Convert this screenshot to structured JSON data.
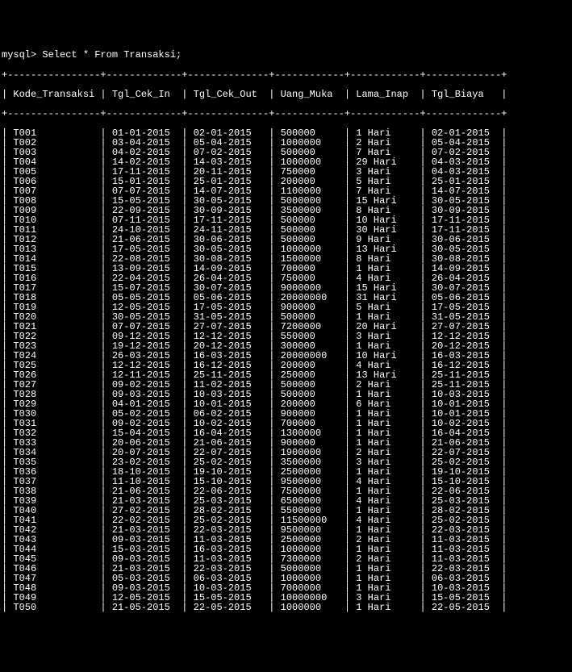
{
  "prompt": "mysql> Select * From Transaksi;",
  "columns": [
    "Kode_Transaksi",
    "Tgl_Cek_In",
    "Tgl_Cek_Out",
    "Uang_Muka",
    "Lama_Inap",
    "Tgl_Biaya"
  ],
  "rows": [
    {
      "kode": "T001",
      "cek_in": "01-01-2015",
      "cek_out": "02-01-2015",
      "uang": "500000",
      "lama": "1 Hari",
      "biaya": "02-01-2015"
    },
    {
      "kode": "T002",
      "cek_in": "03-04-2015",
      "cek_out": "05-04-2015",
      "uang": "1000000",
      "lama": "2 Hari",
      "biaya": "05-04-2015"
    },
    {
      "kode": "T003",
      "cek_in": "04-02-2015",
      "cek_out": "07-02-2015",
      "uang": "500000",
      "lama": "7 Hari",
      "biaya": "07-02-2015"
    },
    {
      "kode": "T004",
      "cek_in": "14-02-2015",
      "cek_out": "14-03-2015",
      "uang": "1000000",
      "lama": "29 Hari",
      "biaya": "04-03-2015"
    },
    {
      "kode": "T005",
      "cek_in": "17-11-2015",
      "cek_out": "20-11-2015",
      "uang": "750000",
      "lama": "3 Hari",
      "biaya": "04-03-2015"
    },
    {
      "kode": "T006",
      "cek_in": "15-01-2015",
      "cek_out": "25-01-2015",
      "uang": "200000",
      "lama": "5 Hari",
      "biaya": "25-01-2015"
    },
    {
      "kode": "T007",
      "cek_in": "07-07-2015",
      "cek_out": "14-07-2015",
      "uang": "1100000",
      "lama": "7 Hari",
      "biaya": "14-07-2015"
    },
    {
      "kode": "T008",
      "cek_in": "15-05-2015",
      "cek_out": "30-05-2015",
      "uang": "5000000",
      "lama": "15 Hari",
      "biaya": "30-05-2015"
    },
    {
      "kode": "T009",
      "cek_in": "22-09-2015",
      "cek_out": "30-09-2015",
      "uang": "3500000",
      "lama": "8 Hari",
      "biaya": "30-09-2015"
    },
    {
      "kode": "T010",
      "cek_in": "07-11-2015",
      "cek_out": "17-11-2015",
      "uang": "500000",
      "lama": "10 Hari",
      "biaya": "17-11-2015"
    },
    {
      "kode": "T011",
      "cek_in": "24-10-2015",
      "cek_out": "24-11-2015",
      "uang": "500000",
      "lama": "30 Hari",
      "biaya": "17-11-2015"
    },
    {
      "kode": "T012",
      "cek_in": "21-06-2015",
      "cek_out": "30-06-2015",
      "uang": "500000",
      "lama": "9 Hari",
      "biaya": "30-06-2015"
    },
    {
      "kode": "T013",
      "cek_in": "17-05-2015",
      "cek_out": "30-05-2015",
      "uang": "1000000",
      "lama": "13 Hari",
      "biaya": "30-05-2015"
    },
    {
      "kode": "T014",
      "cek_in": "22-08-2015",
      "cek_out": "30-08-2015",
      "uang": "1500000",
      "lama": "8 Hari",
      "biaya": "30-08-2015"
    },
    {
      "kode": "T015",
      "cek_in": "13-09-2015",
      "cek_out": "14-09-2015",
      "uang": "700000",
      "lama": "1 Hari",
      "biaya": "14-09-2015"
    },
    {
      "kode": "T016",
      "cek_in": "22-04-2015",
      "cek_out": "26-04-2015",
      "uang": "750000",
      "lama": "4 Hari",
      "biaya": "26-04-2015"
    },
    {
      "kode": "T017",
      "cek_in": "15-07-2015",
      "cek_out": "30-07-2015",
      "uang": "9000000",
      "lama": "15 Hari",
      "biaya": "30-07-2015"
    },
    {
      "kode": "T018",
      "cek_in": "05-05-2015",
      "cek_out": "05-06-2015",
      "uang": "20000000",
      "lama": "31 Hari",
      "biaya": "05-06-2015"
    },
    {
      "kode": "T019",
      "cek_in": "12-05-2015",
      "cek_out": "17-05-2015",
      "uang": "900000",
      "lama": "5 Hari",
      "biaya": "17-05-2015"
    },
    {
      "kode": "T020",
      "cek_in": "30-05-2015",
      "cek_out": "31-05-2015",
      "uang": "500000",
      "lama": "1 Hari",
      "biaya": "31-05-2015"
    },
    {
      "kode": "T021",
      "cek_in": "07-07-2015",
      "cek_out": "27-07-2015",
      "uang": "7200000",
      "lama": "20 Hari",
      "biaya": "27-07-2015"
    },
    {
      "kode": "T022",
      "cek_in": "09-12-2015",
      "cek_out": "12-12-2015",
      "uang": "550000",
      "lama": "3 Hari",
      "biaya": "12-12-2015"
    },
    {
      "kode": "T023",
      "cek_in": "19-12-2015",
      "cek_out": "20-12-2015",
      "uang": "300000",
      "lama": "1 Hari",
      "biaya": "20-12-2015"
    },
    {
      "kode": "T024",
      "cek_in": "26-03-2015",
      "cek_out": "16-03-2015",
      "uang": "20000000",
      "lama": "10 Hari",
      "biaya": "16-03-2015"
    },
    {
      "kode": "T025",
      "cek_in": "12-12-2015",
      "cek_out": "16-12-2015",
      "uang": "200000",
      "lama": "4 Hari",
      "biaya": "16-12-2015"
    },
    {
      "kode": "T026",
      "cek_in": "12-11-2015",
      "cek_out": "25-11-2015",
      "uang": "250000",
      "lama": "13 Hari",
      "biaya": "25-11-2015"
    },
    {
      "kode": "T027",
      "cek_in": "09-02-2015",
      "cek_out": "11-02-2015",
      "uang": "500000",
      "lama": "2 Hari",
      "biaya": "25-11-2015"
    },
    {
      "kode": "T028",
      "cek_in": "09-03-2015",
      "cek_out": "10-03-2015",
      "uang": "500000",
      "lama": "1 Hari",
      "biaya": "10-03-2015"
    },
    {
      "kode": "T029",
      "cek_in": "04-01-2015",
      "cek_out": "10-01-2015",
      "uang": "200000",
      "lama": "6 Hari",
      "biaya": "10-01-2015"
    },
    {
      "kode": "T030",
      "cek_in": "05-02-2015",
      "cek_out": "06-02-2015",
      "uang": "900000",
      "lama": "1 Hari",
      "biaya": "10-01-2015"
    },
    {
      "kode": "T031",
      "cek_in": "09-02-2015",
      "cek_out": "10-02-2015",
      "uang": "700000",
      "lama": "1 Hari",
      "biaya": "10-02-2015"
    },
    {
      "kode": "T032",
      "cek_in": "15-04-2015",
      "cek_out": "16-04-2015",
      "uang": "1300000",
      "lama": "1 Hari",
      "biaya": "16-04-2015"
    },
    {
      "kode": "T033",
      "cek_in": "20-06-2015",
      "cek_out": "21-06-2015",
      "uang": "900000",
      "lama": "1 Hari",
      "biaya": "21-06-2015"
    },
    {
      "kode": "T034",
      "cek_in": "20-07-2015",
      "cek_out": "22-07-2015",
      "uang": "1900000",
      "lama": "2 Hari",
      "biaya": "22-07-2015"
    },
    {
      "kode": "T035",
      "cek_in": "23-02-2015",
      "cek_out": "25-02-2015",
      "uang": "3500000",
      "lama": "3 Hari",
      "biaya": "25-02-2015"
    },
    {
      "kode": "T036",
      "cek_in": "18-10-2015",
      "cek_out": "19-10-2015",
      "uang": "2500000",
      "lama": "1 Hari",
      "biaya": "19-10-2015"
    },
    {
      "kode": "T037",
      "cek_in": "11-10-2015",
      "cek_out": "15-10-2015",
      "uang": "9500000",
      "lama": "4 Hari",
      "biaya": "15-10-2015"
    },
    {
      "kode": "T038",
      "cek_in": "21-06-2015",
      "cek_out": "22-06-2015",
      "uang": "7500000",
      "lama": "1 Hari",
      "biaya": "22-06-2015"
    },
    {
      "kode": "T039",
      "cek_in": "21-03-2015",
      "cek_out": "25-03-2015",
      "uang": "6500000",
      "lama": "4 Hari",
      "biaya": "25-03-2015"
    },
    {
      "kode": "T040",
      "cek_in": "27-02-2015",
      "cek_out": "28-02-2015",
      "uang": "5500000",
      "lama": "1 Hari",
      "biaya": "28-02-2015"
    },
    {
      "kode": "T041",
      "cek_in": "22-02-2015",
      "cek_out": "25-02-2015",
      "uang": "11500000",
      "lama": "4 Hari",
      "biaya": "25-02-2015"
    },
    {
      "kode": "T042",
      "cek_in": "21-03-2015",
      "cek_out": "22-03-2015",
      "uang": "9500000",
      "lama": "1 Hari",
      "biaya": "22-03-2015"
    },
    {
      "kode": "T043",
      "cek_in": "09-03-2015",
      "cek_out": "11-03-2015",
      "uang": "2500000",
      "lama": "2 Hari",
      "biaya": "11-03-2015"
    },
    {
      "kode": "T044",
      "cek_in": "15-03-2015",
      "cek_out": "16-03-2015",
      "uang": "1000000",
      "lama": "1 Hari",
      "biaya": "11-03-2015"
    },
    {
      "kode": "T045",
      "cek_in": "09-03-2015",
      "cek_out": "11-03-2015",
      "uang": "7300000",
      "lama": "2 Hari",
      "biaya": "11-03-2015"
    },
    {
      "kode": "T046",
      "cek_in": "21-03-2015",
      "cek_out": "22-03-2015",
      "uang": "5000000",
      "lama": "1 Hari",
      "biaya": "22-03-2015"
    },
    {
      "kode": "T047",
      "cek_in": "05-03-2015",
      "cek_out": "06-03-2015",
      "uang": "1000000",
      "lama": "1 Hari",
      "biaya": "06-03-2015"
    },
    {
      "kode": "T048",
      "cek_in": "09-03-2015",
      "cek_out": "10-03-2015",
      "uang": "7000000",
      "lama": "1 Hari",
      "biaya": "10-03-2015"
    },
    {
      "kode": "T049",
      "cek_in": "12-05-2015",
      "cek_out": "15-05-2015",
      "uang": "10000000",
      "lama": "3 Hari",
      "biaya": "15-05-2015"
    },
    {
      "kode": "T050",
      "cek_in": "21-05-2015",
      "cek_out": "22-05-2015",
      "uang": "1000000",
      "lama": "1 Hari",
      "biaya": "22-05-2015"
    }
  ]
}
